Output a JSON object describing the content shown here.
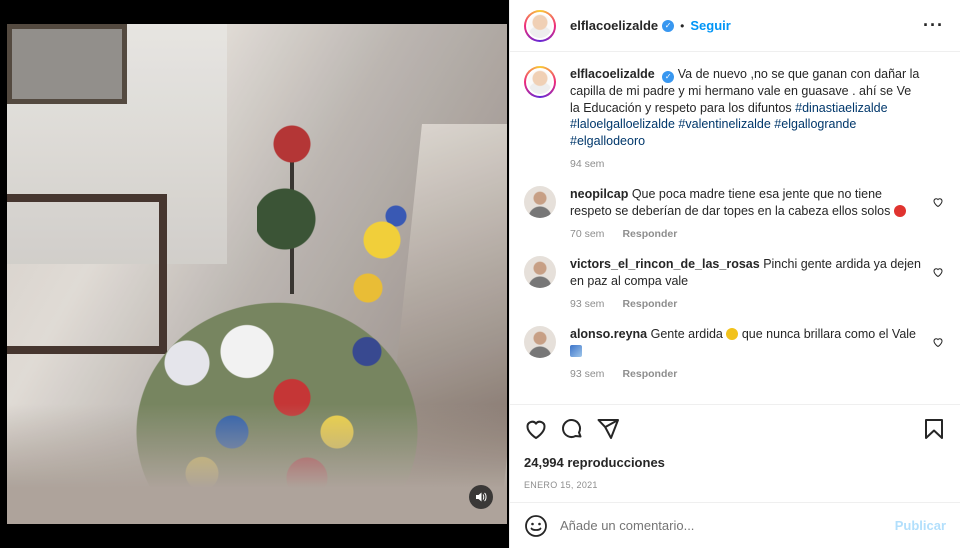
{
  "post": {
    "username": "elflacoelizalde",
    "verified_icon": "verified-check-icon",
    "separator": "•",
    "follow_label": "Seguir",
    "more_icon": "more-options-icon",
    "more_label": "···"
  },
  "caption": {
    "username": "elflacoelizalde",
    "text": "Va de nuevo ,no se que ganan con dañar la capilla de mi padre y mi hermano vale en guasave . ahí se Ve la Educación y respeto para los difuntos ",
    "hashtags": "#dinastiaelizalde #laloelgalloelizalde #valentinelizalde #elgallogrande #elgallodeoro",
    "time": "94 sem"
  },
  "comments": [
    {
      "username": "neopilcap",
      "text": "Que poca madre tiene esa jente que no tiene respeto se deberían de dar topes en la cabeza ellos solos ",
      "emoji": "angry-face",
      "time": "70 sem",
      "reply_label": "Responder"
    },
    {
      "username": "victors_el_rincon_de_las_rosas",
      "text": "Pinchi gente ardida ya dejen en paz al compa vale",
      "time": "93 sem",
      "reply_label": "Responder"
    },
    {
      "username": "alonso.reyna",
      "text": "Gente ardida ",
      "text_2": " que nunca brillara como el Vale ",
      "emoji": "clapping-hands",
      "emoji_2": "syringe",
      "time": "93 sem",
      "reply_label": "Responder"
    }
  ],
  "actions": {
    "like_icon": "heart-icon",
    "comment_icon": "comment-icon",
    "share_icon": "share-icon",
    "save_icon": "bookmark-icon",
    "views": "24,994 reproducciones",
    "date": "ENERO 15, 2021"
  },
  "add_comment": {
    "emoji_icon": "smile-icon",
    "placeholder": "Añade un comentario...",
    "post_label": "Publicar"
  },
  "media": {
    "mute_icon": "speaker-icon",
    "mute_label": "🔊"
  },
  "colors": {
    "accent": "#0095f6",
    "link": "#00376b",
    "muted": "#8e8e8e",
    "post_disabled": "#b2dffc",
    "verified": "#3897f0"
  }
}
